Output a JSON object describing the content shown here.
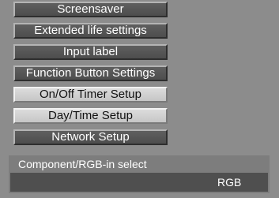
{
  "menu": {
    "items": [
      {
        "label": "Screensaver",
        "style": "dark"
      },
      {
        "label": "Extended life settings",
        "style": "dark"
      },
      {
        "label": "Input label",
        "style": "dark"
      },
      {
        "label": "Function Button Settings",
        "style": "dark"
      },
      {
        "label": "On/Off Timer Setup",
        "style": "light"
      },
      {
        "label": "Day/Time Setup",
        "style": "light"
      },
      {
        "label": "Network Setup",
        "style": "dark"
      }
    ]
  },
  "setting": {
    "label": "Component/RGB-in select",
    "value": "RGB"
  },
  "colors": {
    "background": "#8c8c8c",
    "button_dark": "#575757",
    "button_light": "#d2d2d2",
    "value_box": "#4f4f4f"
  }
}
